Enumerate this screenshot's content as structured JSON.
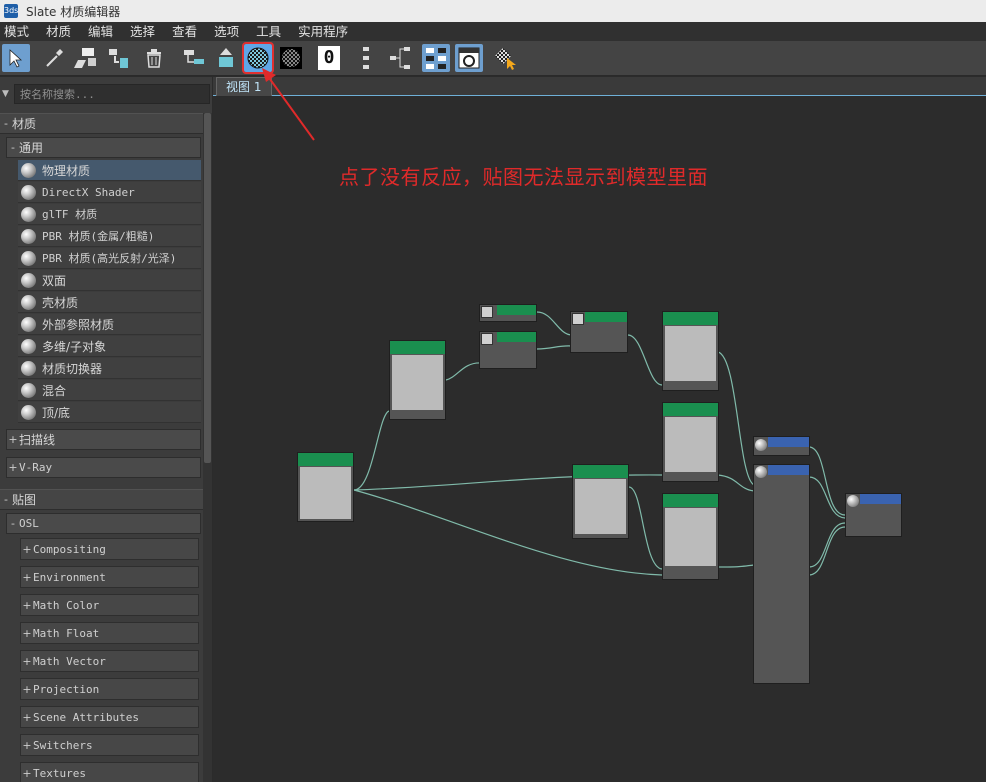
{
  "window": {
    "app_icon": "3ds",
    "title": "Slate 材质编辑器"
  },
  "menu": [
    "模式",
    "材质",
    "编辑",
    "选择",
    "查看",
    "选项",
    "工具",
    "实用程序"
  ],
  "toolbar": {
    "buttons": [
      "select-tool-icon",
      "eyedropper-icon",
      "assign-material-icon",
      "put-to-scene-icon",
      "delete-icon",
      "move-children-icon",
      "pick-icon",
      "show-map-in-viewport-icon",
      "checker-background-icon",
      "material-id-icon",
      "layout-all-icon",
      "layout-children-icon",
      "hide-unused-icon",
      "navigator-icon",
      "select-pick-icon"
    ],
    "material_id_label": "0"
  },
  "search": {
    "placeholder": "按名称搜索..."
  },
  "browser": {
    "materials_header": "材质",
    "general_header": "通用",
    "materials": [
      "物理材质",
      "DirectX Shader",
      "glTF 材质",
      "PBR 材质(金属/粗糙)",
      "PBR 材质(高光反射/光泽)",
      "双面",
      "壳材质",
      "外部参照材质",
      "多维/子对象",
      "材质切换器",
      "混合",
      "顶/底"
    ],
    "scanline_header": "扫描线",
    "vray_header": "V-Ray",
    "maps_header": "贴图",
    "osl_header": "OSL",
    "osl_items": [
      "Compositing",
      "Environment",
      "Math Color",
      "Math Float",
      "Math Vector",
      "Projection",
      "Scene Attributes",
      "Switchers",
      "Textures"
    ]
  },
  "view": {
    "tab": "视图 1"
  },
  "annotation": "点了没有反应，贴图无法显示到模型里面",
  "colors": {
    "accent": "#5fa6e6",
    "annotation": "#e02a2a",
    "node_header": "#1a8f4f",
    "wire": "#8fd3c0"
  }
}
